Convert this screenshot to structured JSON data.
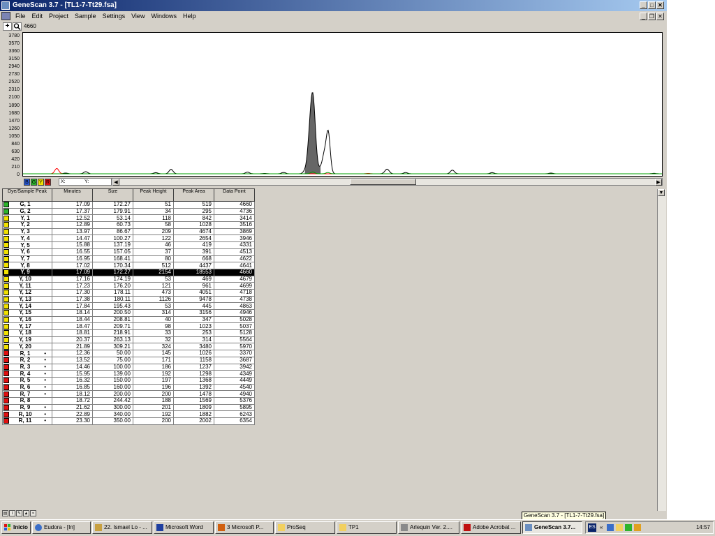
{
  "window": {
    "title": "GeneScan 3.7 - [TL1-7-Tt29.fsa]",
    "buttons": {
      "minimize": "_",
      "maximize": "□",
      "close": "✕",
      "mdi_minimize": "_",
      "mdi_restore": "❐",
      "mdi_close": "✕"
    }
  },
  "menu": [
    "File",
    "Edit",
    "Project",
    "Sample",
    "Settings",
    "View",
    "Windows",
    "Help"
  ],
  "toolbar": {
    "zoom_value": "4660",
    "crosshair_icon": "crosshair-icon",
    "magnifier_icon": "magnifier-icon"
  },
  "chart_data": {
    "type": "line",
    "x_range": [
      3200,
      6420
    ],
    "y_range": [
      0,
      3780
    ],
    "y_ticks": [
      "3780",
      "3570",
      "3360",
      "3150",
      "2940",
      "2730",
      "2520",
      "2310",
      "2100",
      "1890",
      "1680",
      "1470",
      "1260",
      "1050",
      "840",
      "630",
      "420",
      "210",
      "0"
    ],
    "grid": false,
    "series": [
      {
        "color": "#000000",
        "filled_peak": "#666666",
        "peaks": [
          [
            3414,
            20
          ],
          [
            3516,
            58
          ],
          [
            3869,
            30
          ],
          [
            3946,
            122
          ],
          [
            4331,
            46
          ],
          [
            4418,
            10
          ],
          [
            4513,
            37
          ],
          [
            4622,
            80
          ],
          [
            4641,
            430
          ],
          [
            4660,
            2154
          ],
          [
            4699,
            121
          ],
          [
            4718,
            473
          ],
          [
            4738,
            1126
          ],
          [
            5028,
            40
          ],
          [
            5037,
            98
          ],
          [
            5128,
            33
          ],
          [
            5364,
            100
          ],
          [
            5564,
            32
          ],
          [
            5860,
            20
          ],
          [
            6380,
            12
          ]
        ],
        "description": "black trace"
      },
      {
        "color": "#ff0000",
        "peaks": [
          [
            3370,
            145
          ],
          [
            4940,
            10
          ]
        ]
      },
      {
        "color": "#00a000",
        "peaks": [
          [
            4660,
            51
          ],
          [
            4736,
            34
          ]
        ]
      }
    ]
  },
  "plot_controls": {
    "dyes": [
      {
        "label": "B",
        "color": "#2a5bd7"
      },
      {
        "label": "G",
        "color": "#2db42d"
      },
      {
        "label": "Y",
        "color": "#f2e200"
      },
      {
        "label": "R",
        "color": "#e01010"
      }
    ],
    "x_label": "X:",
    "y_label": "Y:"
  },
  "table": {
    "headers": [
      "Dye/Sample Peak",
      "Minutes",
      "Size",
      "Peak Height",
      "Peak Area",
      "Data Point"
    ],
    "selected_index": 10,
    "rows": [
      {
        "color": "#2db42d",
        "peak": "G, 1",
        "mark": "",
        "minutes": "17.09",
        "size": "172.27",
        "height": "51",
        "area": "519",
        "point": "4660"
      },
      {
        "color": "#2db42d",
        "peak": "G, 2",
        "mark": "",
        "minutes": "17.37",
        "size": "179.91",
        "height": "34",
        "area": "295",
        "point": "4736"
      },
      {
        "color": "#f2e200",
        "peak": "Y, 1",
        "mark": "",
        "minutes": "12.52",
        "size": "53.14",
        "height": "118",
        "area": "842",
        "point": "3414"
      },
      {
        "color": "#f2e200",
        "peak": "Y, 2",
        "mark": "",
        "minutes": "12.89",
        "size": "60.73",
        "height": "58",
        "area": "1028",
        "point": "3516"
      },
      {
        "color": "#f2e200",
        "peak": "Y, 3",
        "mark": "",
        "minutes": "13.97",
        "size": "86.67",
        "height": "209",
        "area": "4674",
        "point": "3869"
      },
      {
        "color": "#f2e200",
        "peak": "Y, 4",
        "mark": "",
        "minutes": "14.47",
        "size": "100.27",
        "height": "122",
        "area": "2654",
        "point": "3946"
      },
      {
        "color": "#f2e200",
        "peak": "Y, 5",
        "mark": "",
        "minutes": "15.88",
        "size": "137.19",
        "height": "46",
        "area": "419",
        "point": "4331"
      },
      {
        "color": "#f2e200",
        "peak": "Y, 6",
        "mark": "",
        "minutes": "16.55",
        "size": "157.05",
        "height": "37",
        "area": "391",
        "point": "4513"
      },
      {
        "color": "#f2e200",
        "peak": "Y, 7",
        "mark": "",
        "minutes": "16.95",
        "size": "168.41",
        "height": "80",
        "area": "668",
        "point": "4622"
      },
      {
        "color": "#f2e200",
        "peak": "Y, 8",
        "mark": "",
        "minutes": "17.02",
        "size": "170.34",
        "height": "512",
        "area": "4437",
        "point": "4641"
      },
      {
        "color": "#f2e200",
        "peak": "Y, 9",
        "mark": "",
        "minutes": "17.09",
        "size": "172.27",
        "height": "2154",
        "area": "18553",
        "point": "4660"
      },
      {
        "color": "#f2e200",
        "peak": "Y, 10",
        "mark": "",
        "minutes": "17.16",
        "size": "174.19",
        "height": "53",
        "area": "469",
        "point": "4679"
      },
      {
        "color": "#f2e200",
        "peak": "Y, 11",
        "mark": "",
        "minutes": "17.23",
        "size": "176.20",
        "height": "121",
        "area": "961",
        "point": "4699"
      },
      {
        "color": "#f2e200",
        "peak": "Y, 12",
        "mark": "",
        "minutes": "17.30",
        "size": "178.11",
        "height": "473",
        "area": "4051",
        "point": "4718"
      },
      {
        "color": "#f2e200",
        "peak": "Y, 13",
        "mark": "",
        "minutes": "17.38",
        "size": "180.11",
        "height": "1126",
        "area": "9478",
        "point": "4738"
      },
      {
        "color": "#f2e200",
        "peak": "Y, 14",
        "mark": "",
        "minutes": "17.84",
        "size": "195.43",
        "height": "53",
        "area": "445",
        "point": "4863"
      },
      {
        "color": "#f2e200",
        "peak": "Y, 15",
        "mark": "",
        "minutes": "18.14",
        "size": "200.50",
        "height": "314",
        "area": "3156",
        "point": "4946"
      },
      {
        "color": "#f2e200",
        "peak": "Y, 16",
        "mark": "",
        "minutes": "18.44",
        "size": "208.81",
        "height": "40",
        "area": "347",
        "point": "5028"
      },
      {
        "color": "#f2e200",
        "peak": "Y, 17",
        "mark": "",
        "minutes": "18.47",
        "size": "209.71",
        "height": "98",
        "area": "1023",
        "point": "5037"
      },
      {
        "color": "#f2e200",
        "peak": "Y, 18",
        "mark": "",
        "minutes": "18.81",
        "size": "218.91",
        "height": "33",
        "area": "253",
        "point": "5128"
      },
      {
        "color": "#f2e200",
        "peak": "Y, 19",
        "mark": "",
        "minutes": "20.37",
        "size": "263.13",
        "height": "32",
        "area": "314",
        "point": "5564"
      },
      {
        "color": "#f2e200",
        "peak": "Y, 20",
        "mark": "",
        "minutes": "21.89",
        "size": "309.21",
        "height": "324",
        "area": "3480",
        "point": "5970"
      },
      {
        "color": "#e01010",
        "peak": "R, 1",
        "mark": "•",
        "minutes": "12.36",
        "size": "50.00",
        "height": "145",
        "area": "1026",
        "point": "3370"
      },
      {
        "color": "#e01010",
        "peak": "R, 2",
        "mark": "•",
        "minutes": "13.52",
        "size": "75.00",
        "height": "171",
        "area": "1158",
        "point": "3687"
      },
      {
        "color": "#e01010",
        "peak": "R, 3",
        "mark": "•",
        "minutes": "14.46",
        "size": "100.00",
        "height": "186",
        "area": "1237",
        "point": "3942"
      },
      {
        "color": "#e01010",
        "peak": "R, 4",
        "mark": "•",
        "minutes": "15.95",
        "size": "139.00",
        "height": "192",
        "area": "1298",
        "point": "4349"
      },
      {
        "color": "#e01010",
        "peak": "R, 5",
        "mark": "•",
        "minutes": "16.32",
        "size": "150.00",
        "height": "197",
        "area": "1368",
        "point": "4449"
      },
      {
        "color": "#e01010",
        "peak": "R, 6",
        "mark": "•",
        "minutes": "16.85",
        "size": "160.00",
        "height": "196",
        "area": "1392",
        "point": "4540"
      },
      {
        "color": "#e01010",
        "peak": "R, 7",
        "mark": "•",
        "minutes": "18.12",
        "size": "200.00",
        "height": "200",
        "area": "1478",
        "point": "4940"
      },
      {
        "color": "#e01010",
        "peak": "R, 8",
        "mark": "",
        "minutes": "18.72",
        "size": "244.42",
        "height": "188",
        "area": "1569",
        "point": "5376"
      },
      {
        "color": "#e01010",
        "peak": "R, 9",
        "mark": "•",
        "minutes": "21.62",
        "size": "300.00",
        "height": "201",
        "area": "1809",
        "point": "5895"
      },
      {
        "color": "#e01010",
        "peak": "R, 10",
        "mark": "•",
        "minutes": "22.89",
        "size": "340.00",
        "height": "192",
        "area": "1882",
        "point": "6243"
      },
      {
        "color": "#e01010",
        "peak": "R, 11",
        "mark": "•",
        "minutes": "23.30",
        "size": "350.00",
        "height": "200",
        "area": "2002",
        "point": "6354"
      }
    ]
  },
  "tooltip": "GeneScan 3.7 - [TL1-7-Tt29.fsa]",
  "taskbar": {
    "start": "Inicio",
    "buttons": [
      "Eudora - [In]",
      "22. Ismael Lo - ...",
      "Microsoft Word",
      "3 Microsoft P...",
      "ProSeq",
      "TP1",
      "Arlequin Ver. 2....",
      "Adobe Acrobat ...",
      "GeneScan 3.7..."
    ],
    "lang": "ES",
    "chevron": "«",
    "clock": "14:57"
  }
}
